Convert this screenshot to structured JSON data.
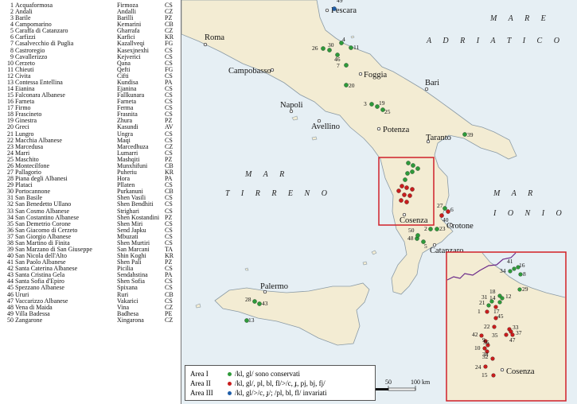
{
  "list": [
    {
      "n": "1",
      "it": "Acquaformosa",
      "ar": "Firmoza",
      "pr": "CS"
    },
    {
      "n": "2",
      "it": "Andali",
      "ar": "Andalli",
      "pr": "CZ"
    },
    {
      "n": "3",
      "it": "Barile",
      "ar": "Barilli",
      "pr": "PZ"
    },
    {
      "n": "4",
      "it": "Campomarino",
      "ar": "Kemarini",
      "pr": "CB"
    },
    {
      "n": "5",
      "it": "Caraffa di Catanzaro",
      "ar": "Gharrafa",
      "pr": "CZ"
    },
    {
      "n": "6",
      "it": "Carfizzi",
      "ar": "Karfici",
      "pr": "KR"
    },
    {
      "n": "7",
      "it": "Casalvecchio di Puglia",
      "ar": "Kazallveqi",
      "pr": "FG"
    },
    {
      "n": "8",
      "it": "Castroregio",
      "ar": "Kasexjnexhi",
      "pr": "CS"
    },
    {
      "n": "9",
      "it": "Cavallerizzo",
      "ar": "Kejverici",
      "pr": "CS"
    },
    {
      "n": "10",
      "it": "Cerzeto",
      "ar": "Qana",
      "pr": "CS"
    },
    {
      "n": "11",
      "it": "Chieuti",
      "ar": "Qefti",
      "pr": "FG"
    },
    {
      "n": "12",
      "it": "Civita",
      "ar": "Cifti",
      "pr": "CS"
    },
    {
      "n": "13",
      "it": "Contessa Entellina",
      "ar": "Kundisa",
      "pr": "PA"
    },
    {
      "n": "14",
      "it": "Eianina",
      "ar": "Ejanina",
      "pr": "CS"
    },
    {
      "n": "15",
      "it": "Falconara Albanese",
      "ar": "Fallkunara",
      "pr": "CS"
    },
    {
      "n": "16",
      "it": "Farneta",
      "ar": "Farneta",
      "pr": "CS"
    },
    {
      "n": "17",
      "it": "Firmo",
      "ar": "Ferma",
      "pr": "CS"
    },
    {
      "n": "18",
      "it": "Frascineto",
      "ar": "Frasnita",
      "pr": "CS"
    },
    {
      "n": "19",
      "it": "Ginestra",
      "ar": "Zhura",
      "pr": "PZ"
    },
    {
      "n": "20",
      "it": "Greci",
      "ar": "Kasundi",
      "pr": "AV"
    },
    {
      "n": "21",
      "it": "Lungro",
      "ar": "Ungra",
      "pr": "CS"
    },
    {
      "n": "22",
      "it": "Macchia Albanese",
      "ar": "Maqi",
      "pr": "CS"
    },
    {
      "n": "23",
      "it": "Marcedusa",
      "ar": "Marcedhuza",
      "pr": "CZ"
    },
    {
      "n": "24",
      "it": "Marri",
      "ar": "Lumarri",
      "pr": "CS"
    },
    {
      "n": "25",
      "it": "Maschito",
      "ar": "Mashqiti",
      "pr": "PZ"
    },
    {
      "n": "26",
      "it": "Montecilfone",
      "ar": "Munxhifuni",
      "pr": "CB"
    },
    {
      "n": "27",
      "it": "Pallagorio",
      "ar": "Puheriu",
      "pr": "KR"
    },
    {
      "n": "28",
      "it": "Piana degli Albanesi",
      "ar": "Hora",
      "pr": "PA"
    },
    {
      "n": "29",
      "it": "Plataci",
      "ar": "Pllaten",
      "pr": "CS"
    },
    {
      "n": "30",
      "it": "Portocannone",
      "ar": "Purkanuni",
      "pr": "CB"
    },
    {
      "n": "31",
      "it": "San Basile",
      "ar": "Shen Vasili",
      "pr": "CS"
    },
    {
      "n": "32",
      "it": "San Benedetto Ullano",
      "ar": "Shen Bendhiti",
      "pr": "CS"
    },
    {
      "n": "33",
      "it": "San Cosmo Albanese",
      "ar": "Strighari",
      "pr": "CS"
    },
    {
      "n": "34",
      "it": "San Costantino Albanese",
      "ar": "Shen Kostandini",
      "pr": "PZ"
    },
    {
      "n": "35",
      "it": "San Demetrio Corone",
      "ar": "Shen Miri",
      "pr": "CS"
    },
    {
      "n": "36",
      "it": "San Giacomo di Cerzeto",
      "ar": "Send Japku",
      "pr": "CS"
    },
    {
      "n": "37",
      "it": "San Giorgio Albanese",
      "ar": "Mbuzati",
      "pr": "CS"
    },
    {
      "n": "38",
      "it": "San Martino di Finita",
      "ar": "Shen Murtiri",
      "pr": "CS"
    },
    {
      "n": "39",
      "it": "San Marzano di San Giuseppe",
      "ar": "San Marcani",
      "pr": "TA"
    },
    {
      "n": "40",
      "it": "San Nicola dell'Alto",
      "ar": "Shin Koghi",
      "pr": "KR"
    },
    {
      "n": "41",
      "it": "San Paolo Albanese",
      "ar": "Shen Pali",
      "pr": "PZ"
    },
    {
      "n": "42",
      "it": "Santa Caterina Albanese",
      "ar": "Picilia",
      "pr": "CS"
    },
    {
      "n": "43",
      "it": "Santa Cristina Gela",
      "ar": "Sendahstina",
      "pr": "PA"
    },
    {
      "n": "44",
      "it": "Santa Sofia d'Epiro",
      "ar": "Shen Sofia",
      "pr": "CS"
    },
    {
      "n": "45",
      "it": "Spezzano Albanese",
      "ar": "Spixana",
      "pr": "CS"
    },
    {
      "n": "46",
      "it": "Ururi",
      "ar": "Ruri",
      "pr": "CB"
    },
    {
      "n": "47",
      "it": "Vaccarizzo Albanese",
      "ar": "Vakarici",
      "pr": "CS"
    },
    {
      "n": "48",
      "it": "Vena di Maida",
      "ar": "Vina",
      "pr": "CZ"
    },
    {
      "n": "49",
      "it": "Villa Badessa",
      "ar": "Badhesa",
      "pr": "PE"
    },
    {
      "n": "50",
      "it": "Zangarone",
      "ar": "Xingarona",
      "pr": "CZ"
    }
  ],
  "seas": {
    "adriatic_1": "M A R E",
    "adriatic_2": "A D R I A T I C O",
    "tirreno_1": "M A R",
    "tirreno_2": "T I R R E N O",
    "ionio_1": "M A R",
    "ionio_2": "I O N I O"
  },
  "cities": [
    {
      "name": "Pescara"
    },
    {
      "name": "Roma"
    },
    {
      "name": "Campobasso"
    },
    {
      "name": "Foggia"
    },
    {
      "name": "Bari"
    },
    {
      "name": "Napoli"
    },
    {
      "name": "Avellino"
    },
    {
      "name": "Potenza"
    },
    {
      "name": "Taranto"
    },
    {
      "name": "Cosenza"
    },
    {
      "name": "Crotone"
    },
    {
      "name": "Catanzaro"
    },
    {
      "name": "Palermo"
    }
  ],
  "inset": {
    "city": "Cosenza"
  },
  "legend": [
    {
      "area": "Area I",
      "color": "#2e9a3a",
      "text": "/kl, gl/ sono conservati"
    },
    {
      "area": "Area II",
      "color": "#c91d1d",
      "text": "/kl, gl/, pl, bl, fl/>/c, ɟ, pj, bj, fj/"
    },
    {
      "area": "Area III",
      "color": "#1f5ea8",
      "text": "/kl, gl/>/c, ɟ/; /pl, bl, fl/ invariati"
    }
  ],
  "scale": {
    "labels": [
      "0",
      "50",
      "100 km"
    ]
  },
  "colors": {
    "land": "#f3ecd3",
    "sea": "#e6eff4",
    "coast": "#8a9aa5",
    "area1": "#2e9a3a",
    "area2": "#c91d1d",
    "area3": "#1f5ea8",
    "frame": "#d0202a",
    "border": "#6b2a8a"
  }
}
